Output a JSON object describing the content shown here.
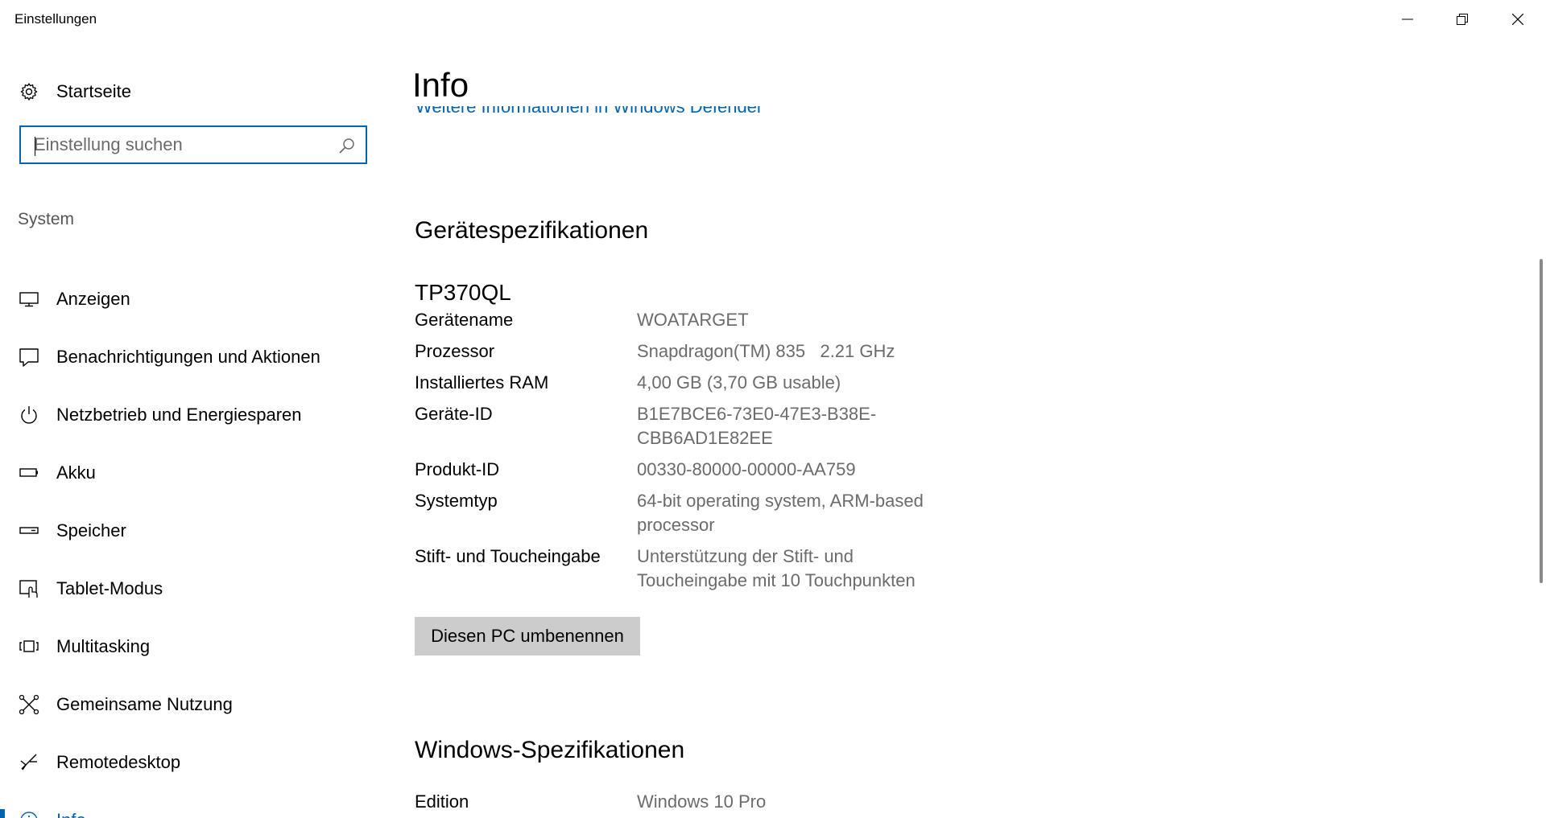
{
  "window": {
    "title": "Einstellungen",
    "controls": {
      "minimize": "minimize-icon",
      "restore": "restore-icon",
      "close": "close-icon"
    }
  },
  "sidebar": {
    "home_label": "Startseite",
    "search": {
      "placeholder": "Einstellung suchen",
      "value": ""
    },
    "section_label": "System",
    "items": [
      {
        "label": "Anzeigen",
        "icon": "monitor-icon",
        "active": false
      },
      {
        "label": "Benachrichtigungen und Aktionen",
        "icon": "notification-icon",
        "active": false
      },
      {
        "label": "Netzbetrieb und Energiesparen",
        "icon": "power-icon",
        "active": false
      },
      {
        "label": "Akku",
        "icon": "battery-icon",
        "active": false
      },
      {
        "label": "Speicher",
        "icon": "storage-icon",
        "active": false
      },
      {
        "label": "Tablet-Modus",
        "icon": "tablet-mode-icon",
        "active": false
      },
      {
        "label": "Multitasking",
        "icon": "multitasking-icon",
        "active": false
      },
      {
        "label": "Gemeinsame Nutzung",
        "icon": "shared-experiences-icon",
        "active": false
      },
      {
        "label": "Remotedesktop",
        "icon": "remote-desktop-icon",
        "active": false
      },
      {
        "label": "Info",
        "icon": "info-icon",
        "active": true
      }
    ]
  },
  "main": {
    "title": "Info",
    "defender_link": "Weitere Informationen in Windows Defender",
    "device_specs": {
      "heading": "Gerätespezifikationen",
      "model": "TP370QL",
      "rows": [
        {
          "key": "Gerätename",
          "value": "WOATARGET"
        },
        {
          "key": "Prozessor",
          "value": "Snapdragon(TM) 835   2.21 GHz"
        },
        {
          "key": "Installiertes RAM",
          "value": "4,00 GB (3,70 GB usable)"
        },
        {
          "key": "Geräte-ID",
          "value": "B1E7BCE6-73E0-47E3-B38E-CBB6AD1E82EE"
        },
        {
          "key": "Produkt-ID",
          "value": "00330-80000-00000-AA759"
        },
        {
          "key": "Systemtyp",
          "value": "64-bit operating system, ARM-based processor"
        },
        {
          "key": "Stift- und Toucheingabe",
          "value": "Unterstützung der Stift- und Toucheingabe mit 10 Touchpunkten"
        }
      ],
      "rename_button": "Diesen PC umbenennen"
    },
    "windows_specs": {
      "heading": "Windows-Spezifikationen",
      "rows": [
        {
          "key": "Edition",
          "value": "Windows 10 Pro"
        }
      ]
    }
  },
  "colors": {
    "accent": "#0063b1",
    "secondary_text": "#6b6b6b",
    "button_bg": "#cccccc"
  }
}
